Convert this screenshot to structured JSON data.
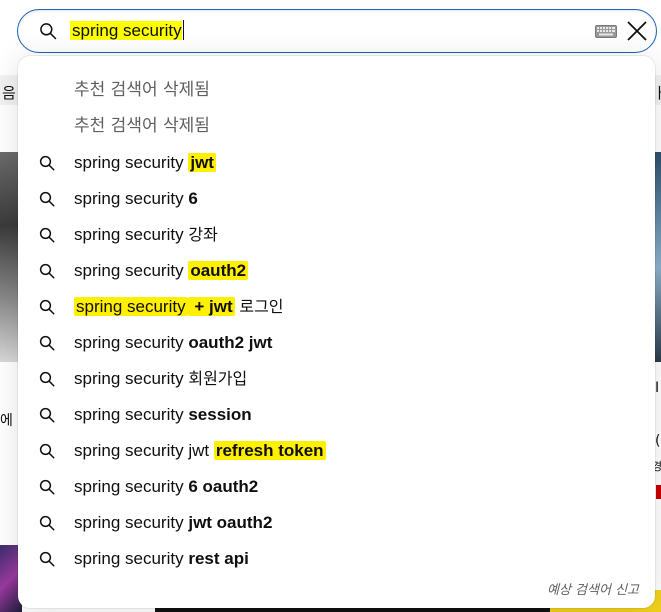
{
  "search": {
    "query": "spring security",
    "input_value": "spring security"
  },
  "icons": {
    "search": "search-icon",
    "keyboard": "keyboard-icon",
    "clear": "close-icon"
  },
  "suggestions": {
    "removed_1": "추천 검색어 삭제됨",
    "removed_2": "추천 검색어 삭제됨",
    "items": [
      {
        "prefix": "spring security",
        "suffix": "jwt"
      },
      {
        "prefix": "spring security",
        "suffix": "6"
      },
      {
        "prefix": "spring security",
        "suffix": "강좌"
      },
      {
        "prefix": "spring security",
        "suffix": "oauth2"
      },
      {
        "prefix": "spring security",
        "suffix": "+ jwt",
        "suffix_kr": "로그인"
      },
      {
        "prefix": "spring security",
        "suffix": "oauth2 jwt"
      },
      {
        "prefix": "spring security",
        "suffix": "회원가입"
      },
      {
        "prefix": "spring security",
        "suffix": "session"
      },
      {
        "prefix": "spring security",
        "suffix_plain": "jwt",
        "suffix": "refresh token"
      },
      {
        "prefix": "spring security",
        "suffix": "6 oauth2"
      },
      {
        "prefix": "spring security",
        "suffix": "jwt oauth2"
      },
      {
        "prefix": "spring security",
        "suffix": "rest api"
      }
    ]
  },
  "footer": {
    "report_label": "예상 검색어 신고"
  },
  "background": {
    "left_edge_text_1": "음",
    "left_edge_text_2": "에 ㄷ",
    "right_edge_text_1": "ㅏ",
    "right_edge_text_2": "I",
    "right_edge_text_3": "(",
    "right_edge_text_4": "경"
  },
  "colors": {
    "accent_border": "#1c62b9",
    "highlighter": "#ffef00"
  }
}
